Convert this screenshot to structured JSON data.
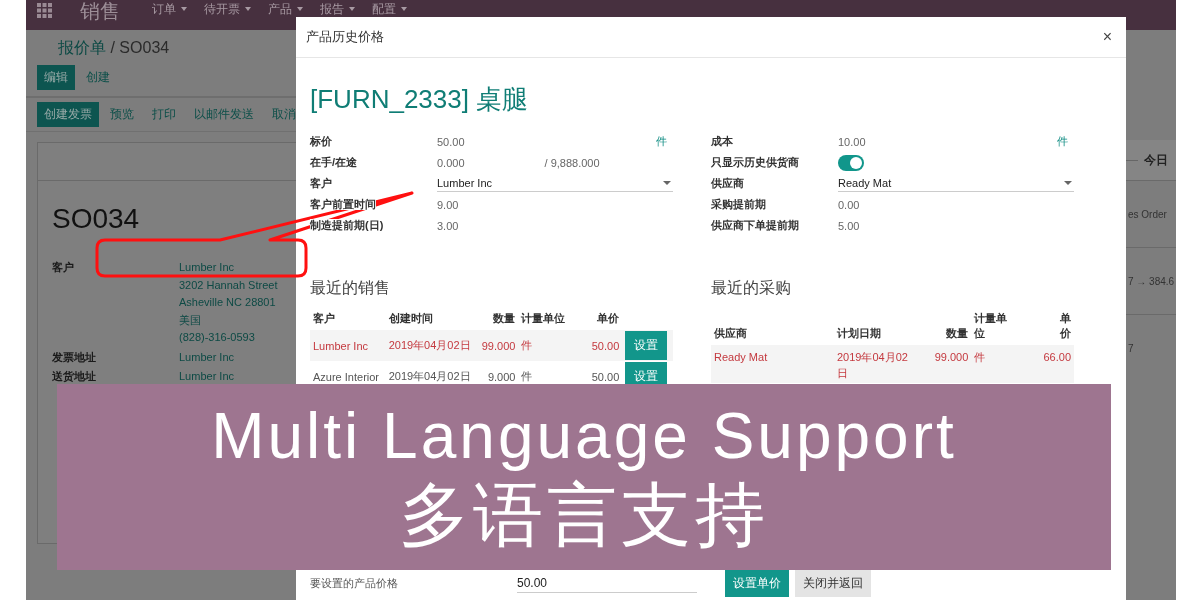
{
  "top_bar": {
    "app_title": "销售",
    "menus": [
      {
        "label": "订单"
      },
      {
        "label": "待开票"
      },
      {
        "label": "产品"
      },
      {
        "label": "报告"
      },
      {
        "label": "配置"
      }
    ]
  },
  "breadcrumb": {
    "parent": "报价单",
    "separator": "/",
    "current": "SO034"
  },
  "form_buttons": [
    {
      "label": "编辑",
      "primary": true
    },
    {
      "label": "创建",
      "primary": false
    }
  ],
  "action_buttons": [
    {
      "label": "创建发票",
      "primary": true
    },
    {
      "label": "预览",
      "primary": false
    },
    {
      "label": "打印",
      "primary": false
    },
    {
      "label": "以邮件发送",
      "primary": false
    },
    {
      "label": "取消",
      "primary": false
    }
  ],
  "sheet": {
    "title": "SO034",
    "fields": [
      {
        "label": "客户",
        "lines": [
          "Lumber Inc",
          "3202 Hannah Street",
          "Asheville NC 28801",
          "美国",
          "(828)-316-0593"
        ]
      },
      {
        "label": "发票地址",
        "lines": [
          "Lumber Inc"
        ]
      },
      {
        "label": "送货地址",
        "lines": [
          "Lumber Inc"
        ]
      }
    ]
  },
  "side_panel": {
    "date_label": "今日",
    "fragments": [
      "es Order",
      "7 → 384.6",
      "7"
    ]
  },
  "dialog": {
    "title": "产品历史价格",
    "close_glyph": "×",
    "product": "[FURN_2333] 桌腿",
    "left_fields": [
      {
        "kind": "text",
        "label": "标价",
        "value": "50.00",
        "unit": "件"
      },
      {
        "kind": "text",
        "label": "在手/在途",
        "value": "0.000",
        "extra": "/ 9,888.000"
      },
      {
        "kind": "select",
        "label": "客户",
        "value": "Lumber Inc"
      },
      {
        "kind": "text",
        "label": "客户前置时间",
        "value": "9.00"
      },
      {
        "kind": "text",
        "label": "制造提前期(日)",
        "value": "3.00"
      }
    ],
    "right_fields": [
      {
        "kind": "text",
        "label": "成本",
        "value": "10.00",
        "unit": "件"
      },
      {
        "kind": "toggle",
        "label": "只显示历史供货商",
        "on": true
      },
      {
        "kind": "select",
        "label": "供应商",
        "value": "Ready Mat"
      },
      {
        "kind": "text",
        "label": "采购提前期",
        "value": "0.00"
      },
      {
        "kind": "text",
        "label": "供应商下单提前期",
        "value": "5.00"
      }
    ],
    "sales": {
      "title": "最近的销售",
      "columns": [
        "客户",
        "创建时间",
        "数量",
        "计量单位",
        "单价"
      ],
      "rows": [
        {
          "cells": [
            "Lumber Inc",
            "2019年04月02日",
            "99.000",
            "件",
            "50.00"
          ],
          "highlighted": true,
          "button": "设置"
        },
        {
          "cells": [
            "Azure Interior",
            "2019年04月02日",
            "9.000",
            "件",
            "50.00"
          ],
          "highlighted": false,
          "button": "设置"
        }
      ]
    },
    "purchases": {
      "title": "最近的采购",
      "columns": [
        "供应商",
        "计划日期",
        "数量",
        "计量单位",
        "单价"
      ],
      "rows": [
        {
          "cells": [
            "Ready Mat",
            "2019年04月02日",
            "99.000",
            "件",
            "66.00"
          ],
          "highlighted": true
        }
      ]
    },
    "footer": {
      "price_label": "要设置的产品价格",
      "price_value": "50.00",
      "buttons": [
        {
          "label": "设置单价",
          "primary": true
        },
        {
          "label": "关闭并返回",
          "primary": false
        }
      ]
    }
  },
  "banner": {
    "title": "Multi Language Support",
    "subtitle": "多语言支持"
  }
}
